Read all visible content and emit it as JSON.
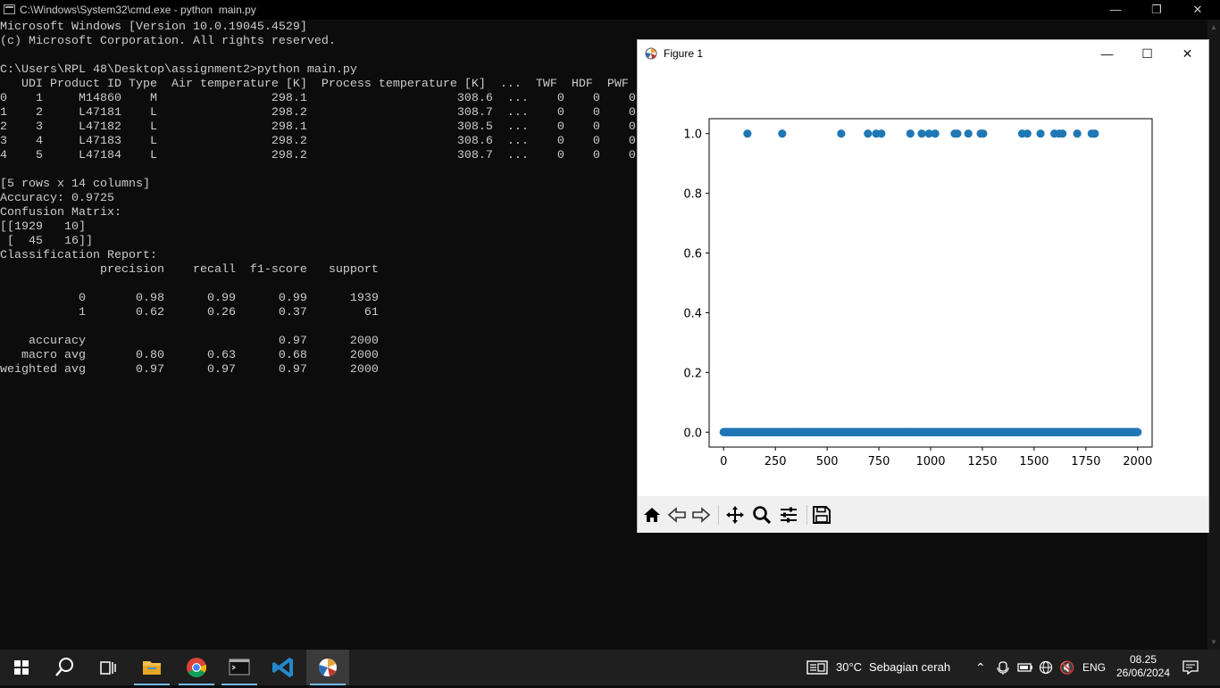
{
  "cmd": {
    "title": "C:\\Windows\\System32\\cmd.exe - python  main.py",
    "lines": [
      "Microsoft Windows [Version 10.0.19045.4529]",
      "(c) Microsoft Corporation. All rights reserved.",
      "",
      "C:\\Users\\RPL 48\\Desktop\\assignment2>python main.py",
      "   UDI Product ID Type  Air temperature [K]  Process temperature [K]  ...  TWF  HDF  PWF",
      "0    1     M14860    M                298.1                     308.6  ...    0    0    0",
      "1    2     L47181    L                298.2                     308.7  ...    0    0    0",
      "2    3     L47182    L                298.1                     308.5  ...    0    0    0",
      "3    4     L47183    L                298.2                     308.6  ...    0    0    0",
      "4    5     L47184    L                298.2                     308.7  ...    0    0    0",
      "",
      "[5 rows x 14 columns]",
      "Accuracy: 0.9725",
      "Confusion Matrix:",
      "[[1929   10]",
      " [  45   16]]",
      "Classification Report:",
      "              precision    recall  f1-score   support",
      "",
      "           0       0.98      0.99      0.99      1939",
      "           1       0.62      0.26      0.37        61",
      "",
      "    accuracy                           0.97      2000",
      "   macro avg       0.80      0.63      0.68      2000",
      "weighted avg       0.97      0.97      0.97      2000"
    ]
  },
  "figure": {
    "title": "Figure 1",
    "toolbar": [
      "home-icon",
      "back-icon",
      "forward-icon",
      "pan-icon",
      "zoom-icon",
      "configure-subplots-icon",
      "save-icon"
    ]
  },
  "chart_data": {
    "type": "scatter",
    "title": "",
    "xlabel": "",
    "ylabel": "",
    "xlim": [
      -70,
      2070
    ],
    "ylim": [
      -0.05,
      1.05
    ],
    "xticks": [
      "0",
      "250",
      "500",
      "750",
      "1000",
      "1250",
      "1500",
      "1750",
      "2000"
    ],
    "yticks": [
      "0.0",
      "0.2",
      "0.4",
      "0.6",
      "0.8",
      "1.0"
    ],
    "series": [
      {
        "color": "#1f77b4",
        "x_ones": [
          115,
          283,
          568,
          697,
          737,
          762,
          902,
          957,
          992,
          1022,
          1116,
          1129,
          1182,
          1242,
          1254,
          1442,
          1467,
          1531,
          1598,
          1620,
          1637,
          1708,
          1778,
          1793
        ],
        "y_zero_range": [
          0,
          2000
        ]
      }
    ]
  },
  "taskbar": {
    "weather_temp": "30°C",
    "weather_desc": "Sebagian cerah",
    "lang": "ENG",
    "time": "08.25",
    "date": "26/06/2024"
  },
  "colors": {
    "console_bg": "#0c0c0c",
    "console_fg": "#cccccc",
    "accent": "#76b9ed",
    "marker": "#1f77b4"
  }
}
